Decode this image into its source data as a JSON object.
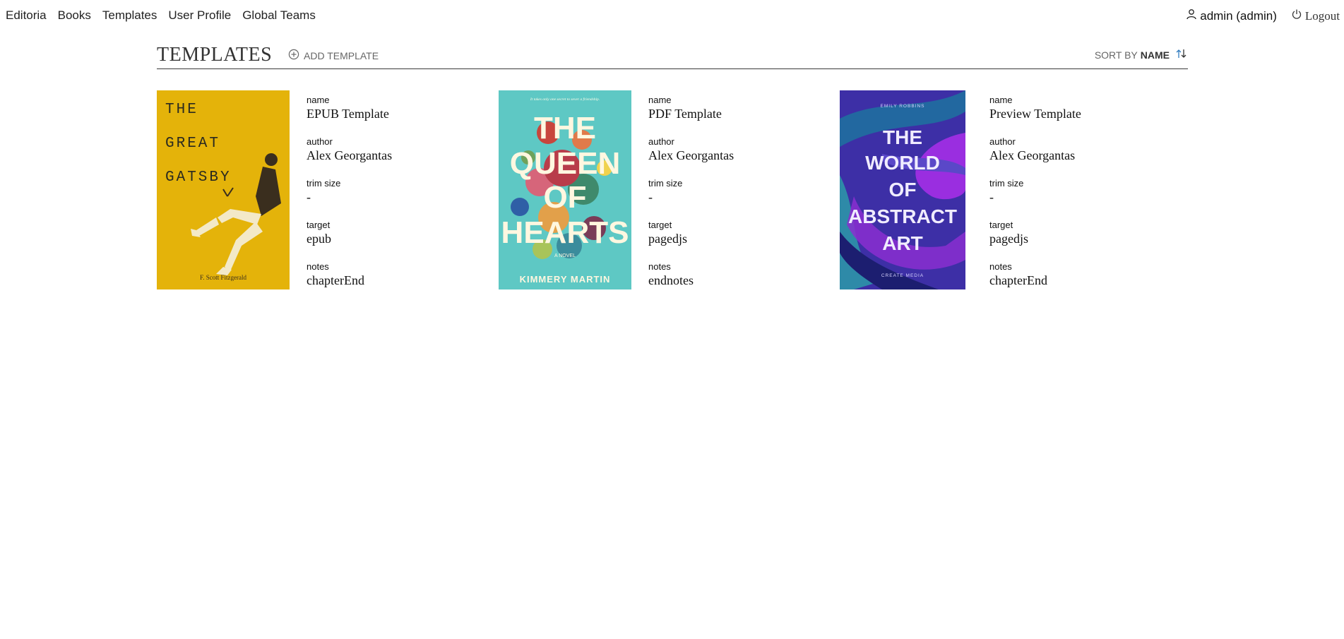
{
  "nav": {
    "items": [
      "Editoria",
      "Books",
      "Templates",
      "User Profile",
      "Global Teams"
    ],
    "user": "admin (admin)",
    "logout": "Logout"
  },
  "header": {
    "title": "Templates",
    "add_label": "Add Template",
    "sort_by_label": "Sort By",
    "sort_value": "Name"
  },
  "templates": [
    {
      "cover": {
        "title_lines": [
          "THE",
          "GREAT",
          "GATSBY"
        ],
        "author": "F. Scott Fitzgerald",
        "bg": "#e8b90e"
      },
      "fields": [
        {
          "label": "name",
          "value": "EPUB Template"
        },
        {
          "label": "author",
          "value": "Alex Georgantas"
        },
        {
          "label": "trim size",
          "value": "-"
        },
        {
          "label": "target",
          "value": "epub"
        },
        {
          "label": "notes",
          "value": "chapterEnd"
        }
      ]
    },
    {
      "cover": {
        "tagline": "It takes only one secret to sever a friendship.",
        "title_lines": [
          "THE",
          "QUEEN",
          "OF",
          "HEARTS"
        ],
        "sub": "A NOVEL",
        "author": "KIMMERY MARTIN",
        "bg": "#5ec8c4"
      },
      "fields": [
        {
          "label": "name",
          "value": "PDF Template"
        },
        {
          "label": "author",
          "value": "Alex Georgantas"
        },
        {
          "label": "trim size",
          "value": "-"
        },
        {
          "label": "target",
          "value": "pagedjs"
        },
        {
          "label": "notes",
          "value": "endnotes"
        }
      ]
    },
    {
      "cover": {
        "top": "EMILY ROBBINS",
        "title_lines": [
          "THE",
          "WORLD",
          "OF",
          "ABSTRACT",
          "ART"
        ],
        "bottom": "CREATE MEDIA",
        "bg": "#3d2fa6"
      },
      "fields": [
        {
          "label": "name",
          "value": "Preview Template"
        },
        {
          "label": "author",
          "value": "Alex Georgantas"
        },
        {
          "label": "trim size",
          "value": "-"
        },
        {
          "label": "target",
          "value": "pagedjs"
        },
        {
          "label": "notes",
          "value": "chapterEnd"
        }
      ]
    }
  ]
}
